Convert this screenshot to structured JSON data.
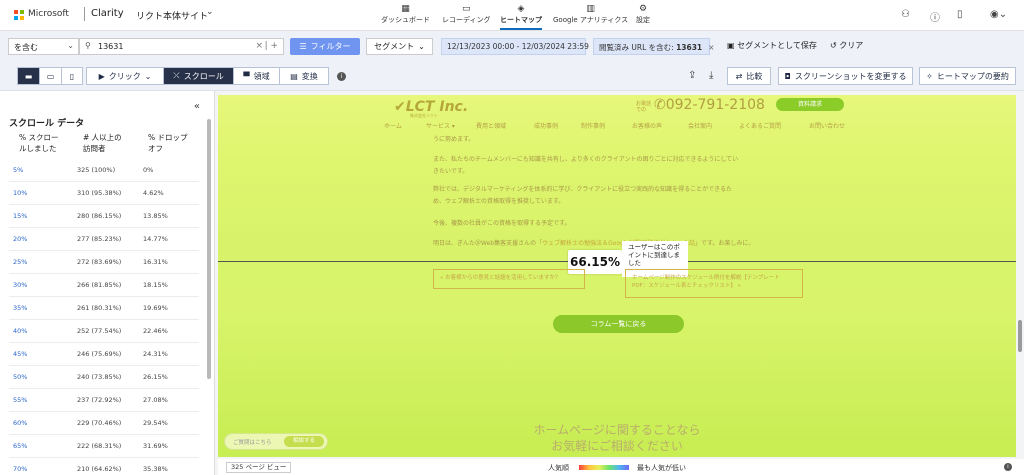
{
  "topbar": {
    "brand": "Microsoft",
    "product": "Clarity",
    "project": "リクト本体サイト",
    "nav": [
      {
        "label": "ダッシュボード",
        "icon": "▦"
      },
      {
        "label": "レコーディング",
        "icon": "▭"
      },
      {
        "label": "ヒートマップ",
        "icon": "◈"
      },
      {
        "label": "Google アナリティクス",
        "icon": "▥"
      },
      {
        "label": "設定",
        "icon": "⚙"
      }
    ]
  },
  "filterbar": {
    "match": "を含む",
    "search_value": "13631",
    "filter_label": "フィルター",
    "segment_label": "セグメント",
    "date_range": "12/13/2023 00:00 - 12/03/2024 23:59",
    "url_chip_prefix": "閲覧済み URL を含む: ",
    "url_chip_value": "13631",
    "save_segment": "セグメントとして保存",
    "clear": "クリア"
  },
  "toolbar": {
    "click": "クリック",
    "scroll": "スクロール",
    "area": "領域",
    "change": "変換",
    "compare": "比較",
    "change_screenshot": "スクリーンショットを変更する",
    "heatmap_summary": "ヒートマップの要約"
  },
  "sidebar": {
    "title": "スクロール データ",
    "col_scrolled": "% スクロー\nルしました",
    "col_visitors": "# 人以上の\n訪問者",
    "col_dropoff": "% ドロップ\nオフ",
    "rows": [
      {
        "pct": "5%",
        "visitors": "325 (100%)",
        "drop": "0%"
      },
      {
        "pct": "10%",
        "visitors": "310 (95.38%)",
        "drop": "4.62%"
      },
      {
        "pct": "15%",
        "visitors": "280 (86.15%)",
        "drop": "13.85%"
      },
      {
        "pct": "20%",
        "visitors": "277 (85.23%)",
        "drop": "14.77%"
      },
      {
        "pct": "25%",
        "visitors": "272 (83.69%)",
        "drop": "16.31%"
      },
      {
        "pct": "30%",
        "visitors": "266 (81.85%)",
        "drop": "18.15%"
      },
      {
        "pct": "35%",
        "visitors": "261 (80.31%)",
        "drop": "19.69%"
      },
      {
        "pct": "40%",
        "visitors": "252 (77.54%)",
        "drop": "22.46%"
      },
      {
        "pct": "45%",
        "visitors": "246 (75.69%)",
        "drop": "24.31%"
      },
      {
        "pct": "50%",
        "visitors": "240 (73.85%)",
        "drop": "26.15%"
      },
      {
        "pct": "55%",
        "visitors": "237 (72.92%)",
        "drop": "27.08%"
      },
      {
        "pct": "60%",
        "visitors": "229 (70.46%)",
        "drop": "29.54%"
      },
      {
        "pct": "65%",
        "visitors": "222 (68.31%)",
        "drop": "31.69%"
      },
      {
        "pct": "70%",
        "visitors": "210 (64.62%)",
        "drop": "35.38%"
      }
    ]
  },
  "heatmap": {
    "logo": "LCT Inc.",
    "logo_sub": "株式会社リクト",
    "phone_label": "お電話\nでの",
    "phone": "092-791-2108",
    "request": "資料請求",
    "nav": [
      "ホーム",
      "サービス ▾",
      "費用と領域",
      "成功事例",
      "制作事例",
      "お客様の声",
      "会社案内",
      "よくあるご質問",
      "お問い合わせ"
    ],
    "text1": "うに努めます。",
    "text2": "また、私たちのチームメンバーにも知識を共有し、より多くのクライアントの困りごとに対応できるようにしてい",
    "text3": "きたいです。",
    "text4": "弊社では、デジタルマーケティングを体系的に学び、クライアントに役立つ実践的な知識を得ることができるた",
    "text5": "め、ウェブ解析士の資格取得を推奨しています。",
    "text6": "今後、複数の社員がこの資格を取得する予定です。",
    "text7_prefix": "明日は、ぎんた＠Web集客支援さんの「",
    "text7_link": "ウェブ解析士の勉強法＆Google試験突破法がよかった話",
    "text7_suffix": "」です。お楽しみに。",
    "fold_percent": "66.15%",
    "fold_desc": "ユーザーはこのポイントに到達しました",
    "prev_link": "« お客様からの意見と話題を活用していますか？",
    "next_link": "ホームページ制作のスケジュール例付を解説【テンプレート PDF：スケジュール表とチェックリスト】 »",
    "column_btn": "コラム一覧に戻る",
    "big1": "ホームページに関することなら",
    "big2": "お気軽にご相談ください",
    "help": "ご質問はこちら",
    "help_btn": "相談する"
  },
  "footer": {
    "page_views": "325 ページ ビュー",
    "popular": "人気順",
    "least": "最も人気が低い"
  }
}
